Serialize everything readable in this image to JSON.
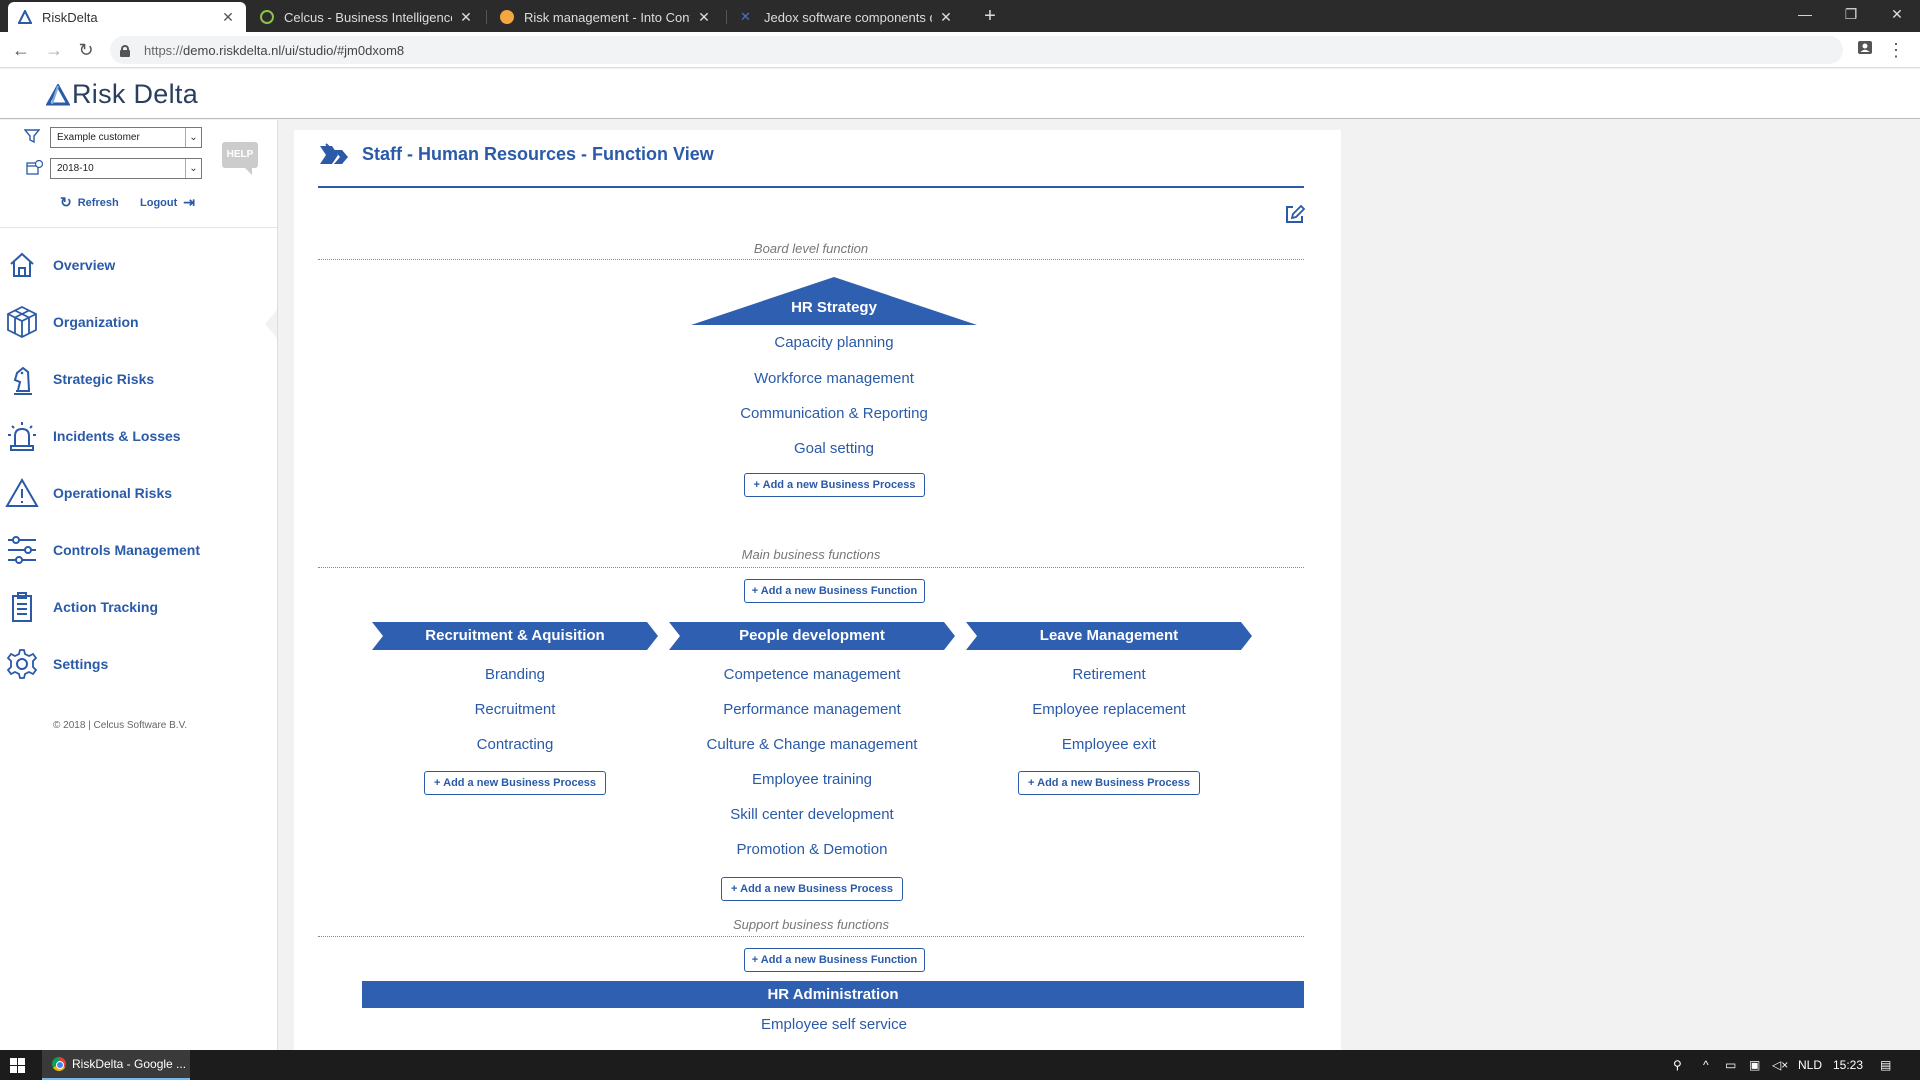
{
  "browser": {
    "tabs": [
      {
        "title": "RiskDelta",
        "active": true
      },
      {
        "title": "Celcus - Business Intelligence en",
        "active": false
      },
      {
        "title": "Risk management - Into Control",
        "active": false
      },
      {
        "title": "Jedox software components driv",
        "active": false
      }
    ],
    "url_scheme": "https://",
    "url_rest": "demo.riskdelta.nl/ui/studio/#jm0dxom8"
  },
  "app": {
    "logo_text": "Risk Delta",
    "brand_color": "#2a5aa8"
  },
  "sidebar": {
    "customer_select": "Example customer",
    "period_select": "2018-10",
    "help_label": "HELP",
    "refresh_label": "Refresh",
    "logout_label": "Logout",
    "nav": [
      {
        "label": "Overview",
        "icon": "home-icon"
      },
      {
        "label": "Organization",
        "icon": "cube-icon"
      },
      {
        "label": "Strategic Risks",
        "icon": "chess-knight-icon"
      },
      {
        "label": "Incidents & Losses",
        "icon": "alarm-light-icon"
      },
      {
        "label": "Operational Risks",
        "icon": "warning-icon"
      },
      {
        "label": "Controls Management",
        "icon": "sliders-icon"
      },
      {
        "label": "Action Tracking",
        "icon": "clipboard-icon"
      },
      {
        "label": "Settings",
        "icon": "gear-icon"
      }
    ],
    "copyright": "© 2018 | Celcus Software B.V."
  },
  "main": {
    "title": "Staff - Human Resources - Function View",
    "board": {
      "section_label": "Board level function",
      "function": "HR Strategy",
      "processes": [
        "Capacity planning",
        "Workforce management",
        "Communication & Reporting",
        "Goal setting"
      ],
      "add_process_label": "+ Add a new Business Process"
    },
    "main_functions": {
      "section_label": "Main business functions",
      "add_function_label": "+ Add a new Business Function",
      "add_process_label": "+ Add a new Business Process",
      "functions": [
        {
          "name": "Recruitment & Aquisition",
          "processes": [
            "Branding",
            "Recruitment",
            "Contracting"
          ]
        },
        {
          "name": "People development",
          "processes": [
            "Competence management",
            "Performance management",
            "Culture & Change management",
            "Employee training",
            "Skill center development",
            "Promotion & Demotion"
          ]
        },
        {
          "name": "Leave Management",
          "processes": [
            "Retirement",
            "Employee replacement",
            "Employee exit"
          ]
        }
      ]
    },
    "support": {
      "section_label": "Support business functions",
      "add_function_label": "+ Add a new Business Function",
      "function": "HR Administration",
      "processes": [
        "Employee self service"
      ]
    }
  },
  "taskbar": {
    "app_label": "RiskDelta - Google ...",
    "language": "NLD",
    "time": "15:23"
  }
}
